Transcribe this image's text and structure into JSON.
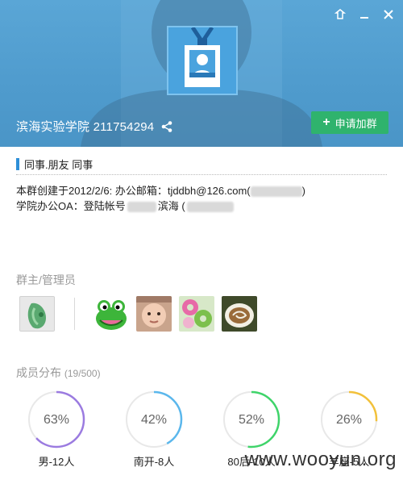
{
  "header": {
    "group_name": "滨海实验学院 211754294",
    "join_button_label": "申请加群"
  },
  "tags": "同事.朋友  同事",
  "info": {
    "line1": "本群创建于2012/2/6:  办公邮箱：tjddbh@126.com(",
    "line1_end": ")",
    "line2": "学院办公OA：登陆帐号",
    "line2_mid": "滨海 ("
  },
  "admins_section": {
    "title": "群主/管理员"
  },
  "members_section": {
    "title": "成员分布",
    "count": "(19/500)"
  },
  "stats": [
    {
      "percent_text": "63%",
      "label": "男-12人",
      "value": 0.63,
      "color": "#9b7be0"
    },
    {
      "percent_text": "42%",
      "label": "南开-8人",
      "value": 0.42,
      "color": "#5bb7ec"
    },
    {
      "percent_text": "52%",
      "label": "80后-10人",
      "value": 0.52,
      "color": "#3fd46a"
    },
    {
      "percent_text": "26%",
      "label": "羊座-5人",
      "value": 0.26,
      "color": "#f2c13b"
    }
  ],
  "watermark": "www.wooyun.org"
}
